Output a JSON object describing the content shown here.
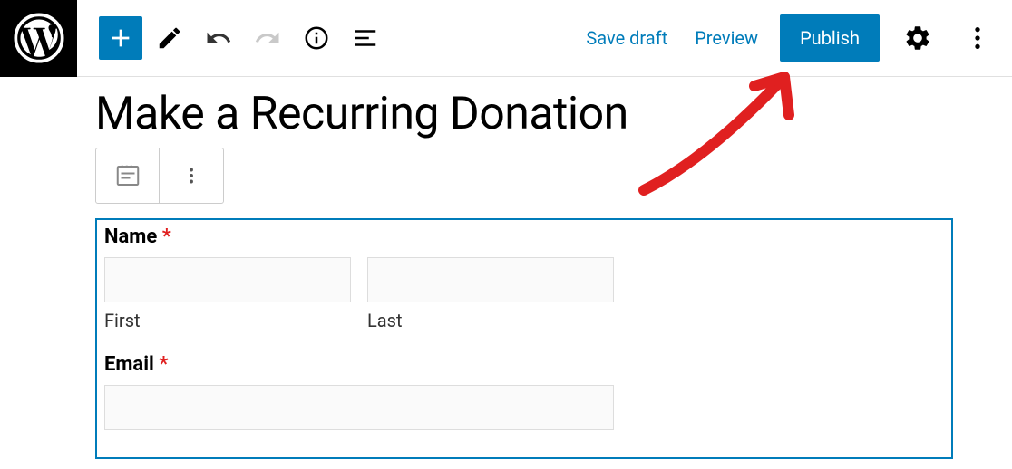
{
  "toolbar": {
    "save_draft_label": "Save draft",
    "preview_label": "Preview",
    "publish_label": "Publish"
  },
  "page": {
    "title": "Make a Recurring Donation"
  },
  "form": {
    "name_label": "Name",
    "name_required": "*",
    "first_sublabel": "First",
    "last_sublabel": "Last",
    "email_label": "Email",
    "email_required": "*"
  }
}
